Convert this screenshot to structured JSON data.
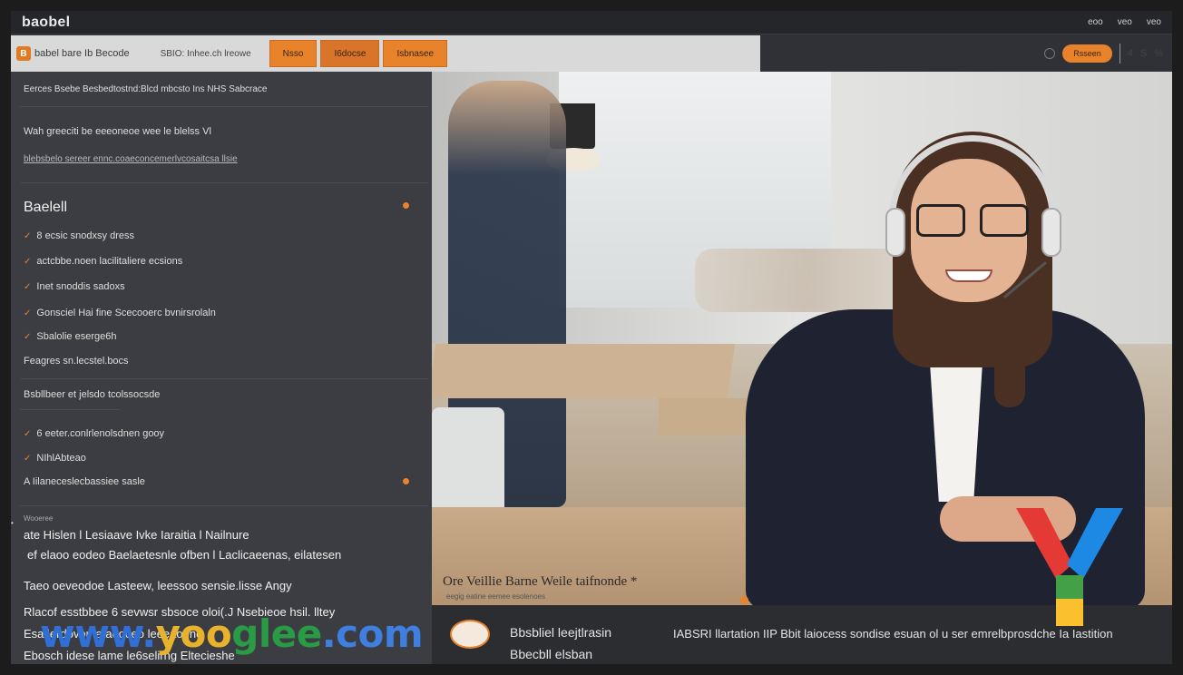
{
  "app": {
    "title": "baobel",
    "top_links": [
      "eoo",
      "veo",
      "veo"
    ]
  },
  "nav": {
    "brand_name": "babel bare Ib Becode",
    "subtitle": "SBIO: Inhee.ch lreowe",
    "buttons": [
      "Nsso",
      "I6docse",
      "Isbnasee"
    ]
  },
  "header_right": {
    "signup_label": "Rsseen",
    "glyphs": [
      "4",
      "S",
      "%"
    ]
  },
  "sidebar": {
    "line1": "Eerces Bsebe Besbedtostnd:Blcd mbcsto Ins NHS Sabcrace",
    "line2": "Wah greeciti be eeeoneoe wee le blelss Vl",
    "line3": "blebsbelo sereer ennc.coaeconcemerlvcosaitcsa llsie",
    "section_title": "Baelell",
    "checklist": [
      "8 ecsic snodxsy dress",
      "actcbbe.noen lacilitaliere ecsions",
      "Inet snoddis sadoxs",
      "Gonsciel Hai fine Scecooerc bvnirsrolaln",
      "Sbalolie eserge6h"
    ],
    "plain_item": "Feagres sn.lecstel.bocs",
    "subsection": "Bsbllbeer et jelsdo tcolssocsde",
    "checklist2": [
      "6 eeter.conlrlenolsdnen gooy",
      "NIhlAbteao"
    ],
    "emph_item": "A Iilaneceslecbassiee sasle",
    "small_label": "Wooeree",
    "para": [
      "ate Hislen l Lesiaave Ivke Iaraitia l Nailnure",
      "ef elaoo eodeo Baelaetesnle ofben l Laclicaeenas, eilatesen",
      "Taeo oeveodoe Lasteew, leessoo sensie.lisse Angy",
      "Rlacof esstbbee 6 sevwsr sbsoce oloi(.J Nsebieoe hsil. lltey",
      "Esa lerdovor lafaeoceo leeeaoeno",
      "Ebosch idese lame le6selirng Eltecieshe"
    ]
  },
  "photo": {
    "caption": "Ore Veillie Barne Weile taifnonde *",
    "subcaption": "eegig eatine eemee esolenoes"
  },
  "bottombar": {
    "title_line1": "Bbsbliel leejtlrasin",
    "title_line2": "Bbecbll elsban",
    "description": "IABSRI llartation IIP Bbit laiocess sondise esuan ol u ser emrelbprosdche Ia Iastition"
  },
  "watermark": {
    "part1": "www.",
    "part2": "yoo",
    "part3": "glee",
    "part4": ".com"
  },
  "colors": {
    "accent": "#e8832b",
    "sidebar_bg": "#3b3d42",
    "topbar_bg": "#24262a",
    "nav_bg": "#d9d9d9"
  },
  "icons": [
    "brand-logo-icon",
    "check-icon",
    "orange-dot-icon",
    "settings-circle-icon",
    "y-brand-mark-icon",
    "avatar-icon"
  ]
}
